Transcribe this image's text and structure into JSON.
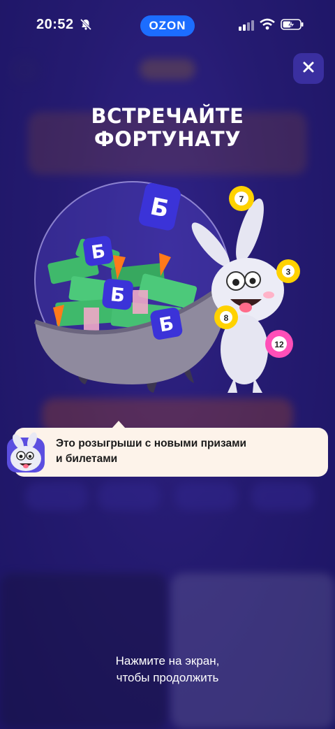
{
  "status_bar": {
    "time": "20:52",
    "icons": [
      "bell-muted-icon",
      "signal-icon",
      "wifi-icon",
      "battery-charging-icon"
    ]
  },
  "brand": {
    "label": "OZON",
    "color": "#1c6dff"
  },
  "close": {
    "icon": "close-icon"
  },
  "headline": {
    "line1": "ВСТРЕЧАЙТЕ",
    "line2": "ФОРТУНАТУ"
  },
  "illustration": {
    "bank_badge": "Б",
    "balls": [
      "7",
      "3",
      "8",
      "12"
    ]
  },
  "tooltip": {
    "line1": "Это розыгрыши с новыми призами",
    "line2": "и билетами"
  },
  "continue": {
    "line1": "Нажмите на экран,",
    "line2": "чтобы продолжить"
  }
}
